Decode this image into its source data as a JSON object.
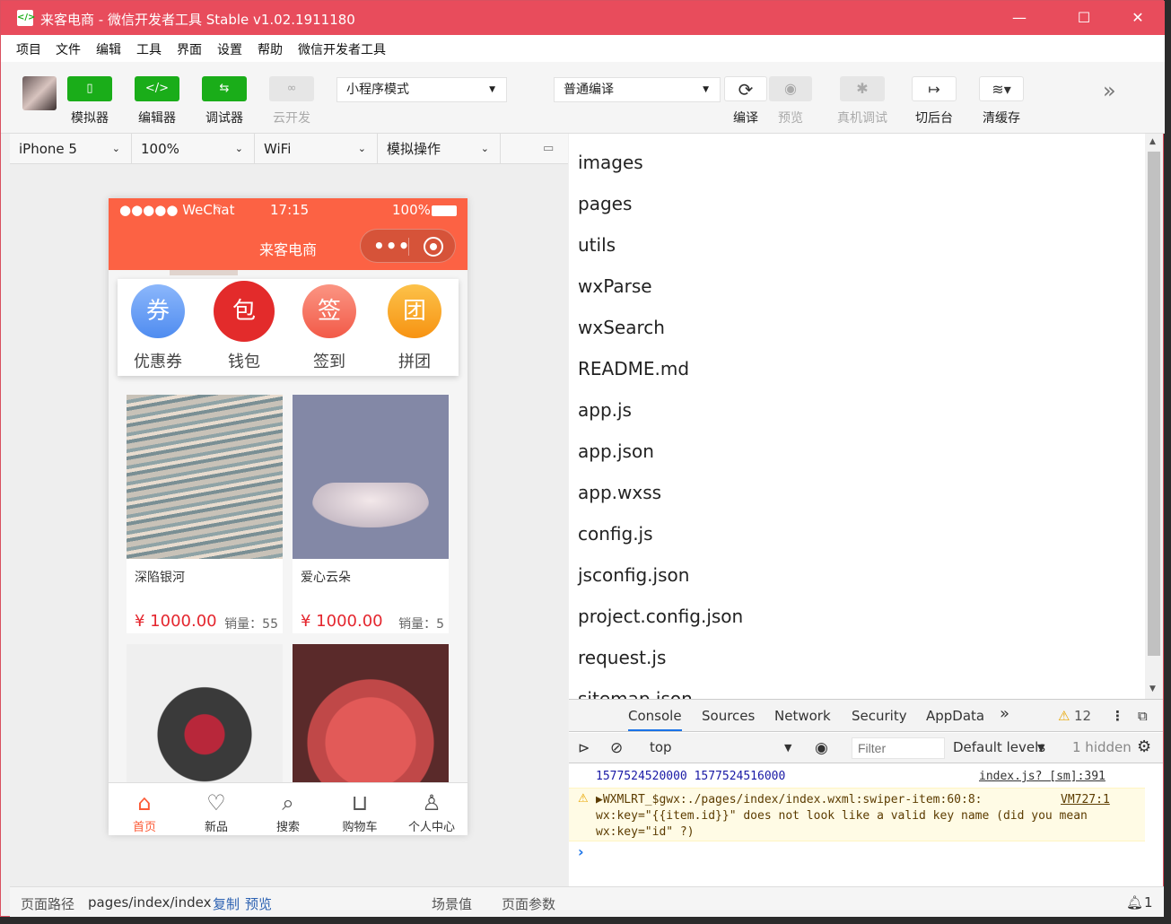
{
  "window": {
    "title": "来客电商 - 微信开发者工具 Stable v1.02.1911180",
    "controls": {
      "minimize": "—",
      "maximize": "☐",
      "close": "✕"
    }
  },
  "menu": [
    "项目",
    "文件",
    "编辑",
    "工具",
    "界面",
    "设置",
    "帮助",
    "微信开发者工具"
  ],
  "toolbar": {
    "simulator": "模拟器",
    "editor": "编辑器",
    "debugger": "调试器",
    "cloud": "云开发",
    "mode_select": "小程序模式",
    "compile_select": "普通编译",
    "compile": "编译",
    "preview": "预览",
    "remote_debug": "真机调试",
    "background": "切后台",
    "clear_cache": "清缓存",
    "more": "»"
  },
  "device_bar": {
    "device": "iPhone 5",
    "zoom": "100%",
    "network": "WiFi",
    "operation": "模拟操作"
  },
  "phone": {
    "status": {
      "carrier": "●●●●● WeChat",
      "wifi": "wifi",
      "time": "17:15",
      "battery": "100%"
    },
    "nav_title": "来客电商",
    "capsule_dots": "•••",
    "icons": [
      {
        "glyph": "券",
        "label": "优惠券",
        "color": "#5b9cf5"
      },
      {
        "glyph": "包",
        "label": "钱包",
        "color": "#e32b2b"
      },
      {
        "glyph": "签",
        "label": "签到",
        "color": "#f86d5a"
      },
      {
        "glyph": "团",
        "label": "拼团",
        "color": "#f9a020"
      }
    ],
    "products": [
      {
        "name": "深陷银河",
        "price": "¥ 1000.00",
        "sales": "销量：55"
      },
      {
        "name": "爱心云朵",
        "price": "¥ 1000.00",
        "sales": "销量：5"
      }
    ],
    "tabs": [
      {
        "icon": "home-icon",
        "label": "首页"
      },
      {
        "icon": "bag-icon",
        "label": "新品"
      },
      {
        "icon": "search-icon",
        "label": "搜索"
      },
      {
        "icon": "cart-icon",
        "label": "购物车"
      },
      {
        "icon": "user-icon",
        "label": "个人中心"
      }
    ]
  },
  "files": [
    "images",
    "pages",
    "utils",
    "wxParse",
    "wxSearch",
    "README.md",
    "app.js",
    "app.json",
    "app.wxss",
    "config.js",
    "jsconfig.json",
    "project.config.json",
    "request.js",
    "sitemap.json"
  ],
  "devtools": {
    "tabs": [
      "Console",
      "Sources",
      "Network",
      "Security",
      "AppData"
    ],
    "more": "»",
    "warn_count": "12",
    "context": "top",
    "filter_placeholder": "Filter",
    "levels": "Default levels",
    "hidden": "1 hidden",
    "log": {
      "text": "1577524520000 1577524516000",
      "source": "index.js? [sm]:391"
    },
    "warning": {
      "line1": "▶WXMLRT_$gwx:./pages/index/index.wxml:swiper-item:60:8:",
      "source": "VM727:1",
      "line2": "wx:key=\"{{item.id}}\" does not look like a valid key name (did you mean",
      "line3": "wx:key=\"id\" ?)"
    },
    "prompt": "›"
  },
  "footer": {
    "path_label": "页面路径",
    "path": "pages/index/index",
    "copy": "复制",
    "preview": "预览",
    "scene": "场景值",
    "params": "页面参数",
    "notif_count": "1"
  }
}
